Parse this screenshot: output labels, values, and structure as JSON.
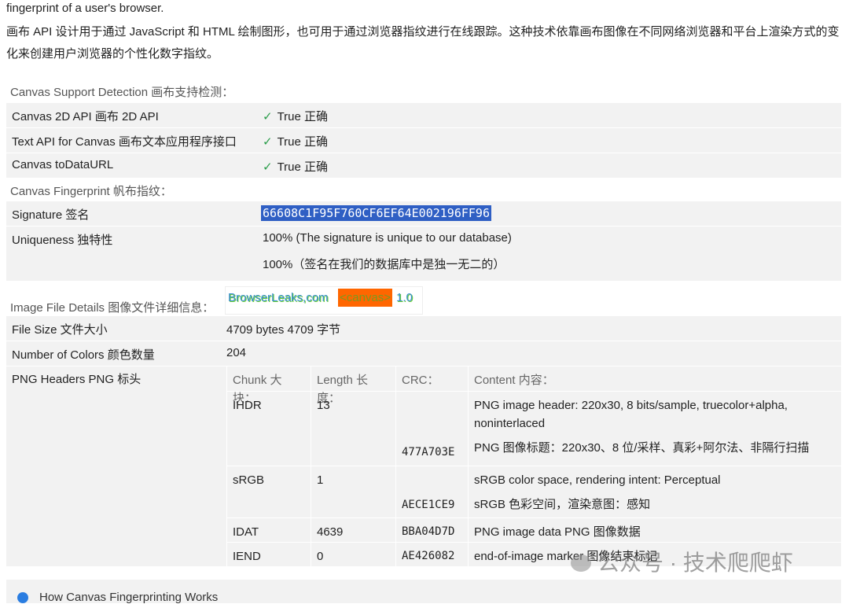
{
  "intro": {
    "en_tail": "fingerprint of a user's browser.",
    "zh": "画布 API 设计用于通过 JavaScript 和 HTML 绘制图形，也可用于通过浏览器指纹进行在线跟踪。这种技术依靠画布图像在不同网络浏览器和平台上渲染方式的变化来创建用户浏览器的个性化数字指纹。"
  },
  "support": {
    "title": "Canvas Support Detection 画布支持检测：",
    "rows": [
      {
        "label": "Canvas 2D API 画布 2D API",
        "value": "True 正确"
      },
      {
        "label": "Text API for Canvas 画布文本应用程序接口",
        "value": "True 正确"
      },
      {
        "label": "Canvas toDataURL",
        "value": "True 正确"
      }
    ]
  },
  "fingerprint": {
    "title": "Canvas Fingerprint 帆布指纹：",
    "signature_label": "Signature 签名",
    "signature": "66608C1F95F760CF6EF64E002196FF96",
    "uniqueness_label": "Uniqueness 独特性",
    "uniqueness_en": "100% (The signature is unique to our database)",
    "uniqueness_zh": "100%（签名在我们的数据库中是独一无二的）"
  },
  "image": {
    "title": "Image File Details 图像文件详细信息：",
    "preview": {
      "site": "BrowserLeaks,com",
      "tag": "<canvas>",
      "ver": "1.0"
    },
    "file_size_label": "File Size 文件大小",
    "file_size": "4709 bytes 4709 字节",
    "colors_label": "Number of Colors 颜色数量",
    "colors": "204",
    "png_label": "PNG Headers PNG 标头",
    "headers": [
      "Chunk 大块：",
      "Length 长度：",
      "CRC：",
      "Content 内容："
    ],
    "chunks": [
      {
        "chunk": "IHDR",
        "length": "13",
        "crc": "477A703E",
        "en": "PNG image header: 220x30, 8 bits/sample, truecolor+alpha, noninterlaced",
        "zh": "PNG 图像标题：220x30、8 位/采样、真彩+阿尔法、非隔行扫描"
      },
      {
        "chunk": "sRGB",
        "length": "1",
        "crc": "AECE1CE9",
        "en": "sRGB color space, rendering intent: Perceptual",
        "zh": "sRGB 色彩空间，渲染意图：感知"
      },
      {
        "chunk": "IDAT",
        "length": "4639",
        "crc": "BBA04D7D",
        "en": "PNG image data PNG 图像数据"
      },
      {
        "chunk": "IEND",
        "length": "0",
        "crc": "AE426082",
        "en": "end-of-image marker 图像结束标记"
      }
    ]
  },
  "next_section": "How Canvas Fingerprinting Works",
  "watermark": "公众号 · 技术爬爬虾"
}
